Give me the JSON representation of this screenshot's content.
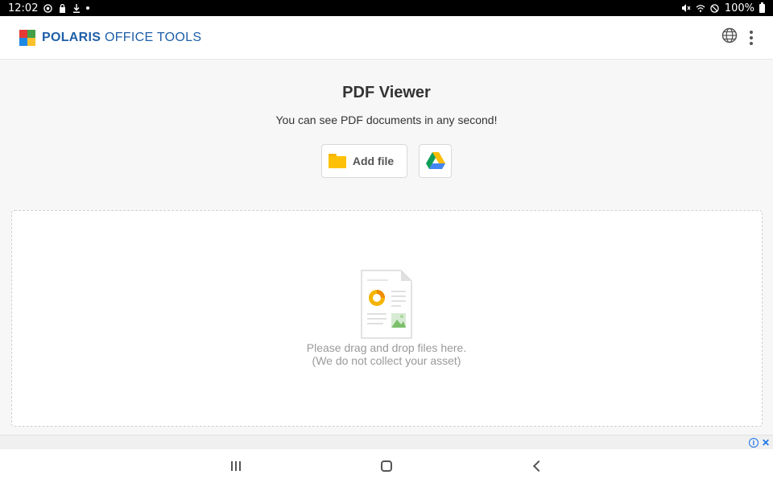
{
  "status_bar": {
    "time": "12:02",
    "battery": "100%",
    "left_icons": [
      "chrome-icon",
      "lock-icon",
      "download-icon",
      "dot-icon"
    ],
    "right_icons": [
      "mute-icon",
      "wifi-icon",
      "do-not-disturb-icon",
      "battery-icon"
    ]
  },
  "header": {
    "brand_bold": "POLARIS",
    "brand_rest": " OFFICE TOOLS",
    "actions": [
      "globe-icon",
      "more-vert-icon"
    ],
    "brand_color": "#1f5fa8"
  },
  "hero": {
    "title": "PDF Viewer",
    "subtitle": "You can see PDF documents in any second!",
    "add_file_label": "Add file",
    "drive_button_icon": "google-drive-icon"
  },
  "dropzone": {
    "line1": "Please drag and drop files here.",
    "line2": "(We do not collect your asset)"
  },
  "ad": {
    "icons": [
      "ad-info-icon",
      "ad-close-icon"
    ]
  },
  "nav": {
    "buttons": [
      "recents-icon",
      "home-icon",
      "back-icon"
    ]
  }
}
